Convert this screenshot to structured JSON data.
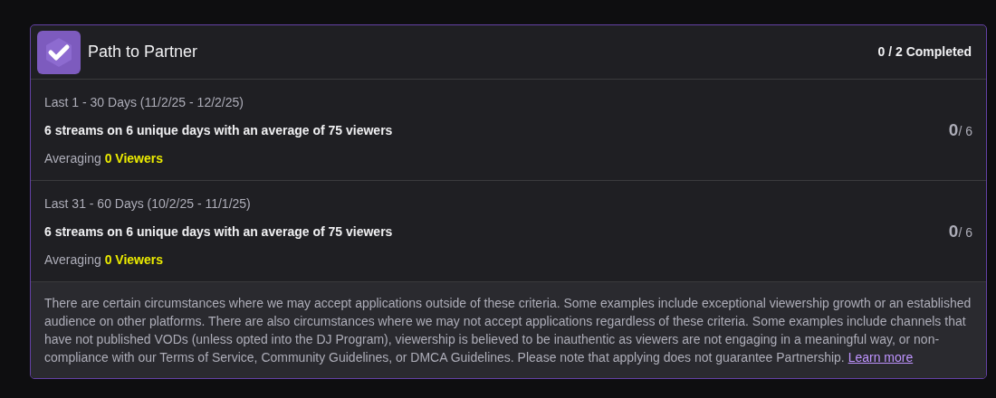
{
  "header": {
    "title": "Path to Partner",
    "progress": "0 / 2 Completed"
  },
  "criteria": [
    {
      "period": "Last 1 - 30 Days (11/2/25 - 12/2/25)",
      "requirement": "6 streams on 6 unique days with an average of 75 viewers",
      "averaging_label": "Averaging",
      "averaging_value": "0 Viewers",
      "count": "0",
      "total": "/ 6"
    },
    {
      "period": "Last 31 - 60 Days (10/2/25 - 11/1/25)",
      "requirement": "6 streams on 6 unique days with an average of 75 viewers",
      "averaging_label": "Averaging",
      "averaging_value": "0 Viewers",
      "count": "0",
      "total": "/ 6"
    }
  ],
  "note": {
    "text": "There are certain circumstances where we may accept applications outside of these criteria. Some examples include exceptional viewership growth or an established audience on other platforms. There are also circumstances where we may not accept applications regardless of these criteria. Some examples include channels that have not published VODs (unless opted into the DJ Program), viewership is believed to be inauthentic as viewers are not engaging in a meaningful way, or non-compliance with our Terms of Service, Community Guidelines, or DMCA Guidelines. Please note that applying does not guarantee Partnership.",
    "link": "Learn more"
  }
}
